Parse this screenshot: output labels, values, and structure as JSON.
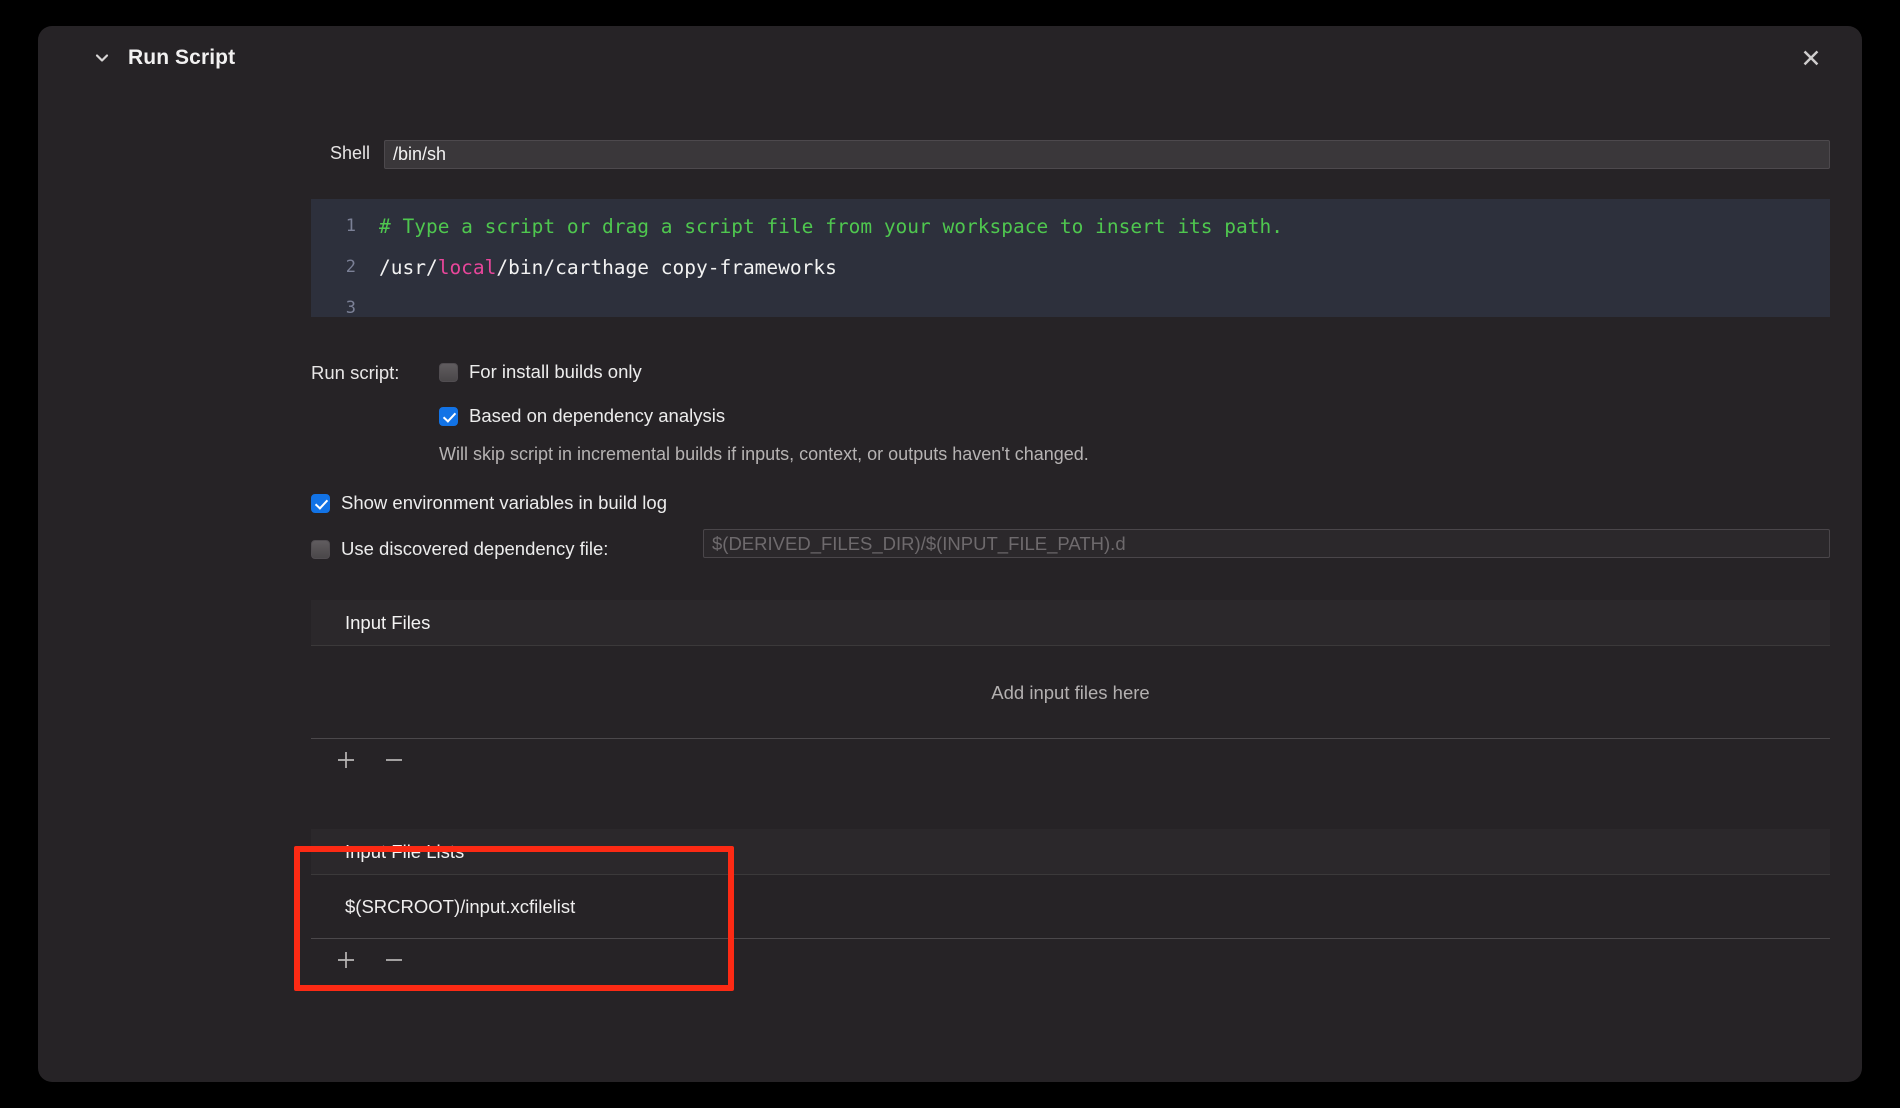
{
  "header": {
    "title": "Run Script",
    "disclosure_icon": "chevron-down-icon",
    "close_icon": "close-icon"
  },
  "shell": {
    "label": "Shell",
    "value": "/bin/sh"
  },
  "editor": {
    "line_numbers": [
      "1",
      "2",
      "3"
    ],
    "line1_comment": "# Type a script or drag a script file from your workspace to insert its path.",
    "line2_part1": "/usr/",
    "line2_keyword": "local",
    "line2_part2": "/bin/carthage copy-frameworks",
    "line3": ""
  },
  "options": {
    "run_script_label": "Run script:",
    "install_builds": {
      "label": "For install builds only",
      "checked": false
    },
    "dependency_analysis": {
      "label": "Based on dependency analysis",
      "checked": true
    },
    "dependency_hint": "Will skip script in incremental builds if inputs, context, or outputs haven't changed.",
    "show_env_vars": {
      "label": "Show environment variables in build log",
      "checked": true
    },
    "use_dependency_file": {
      "label": "Use discovered dependency file:",
      "checked": false,
      "placeholder": "$(DERIVED_FILES_DIR)/$(INPUT_FILE_PATH).d",
      "value": ""
    }
  },
  "input_files": {
    "header": "Input Files",
    "empty_text": "Add input files here",
    "rows": [],
    "add_icon": "plus-icon",
    "remove_icon": "minus-icon"
  },
  "input_file_lists": {
    "header": "Input File Lists",
    "rows": [
      {
        "path": "$(SRCROOT)/input.xcfilelist"
      }
    ],
    "add_icon": "plus-icon",
    "remove_icon": "minus-icon"
  },
  "annotation": {
    "highlight_color": "#fc2a14"
  },
  "colors": {
    "panel_background": "#262326",
    "page_background": "#000000",
    "accent_blue": "#1273e6",
    "editor_background": "#2d303c",
    "comment_green": "#4fc74f",
    "keyword_pink": "#e8469b"
  }
}
